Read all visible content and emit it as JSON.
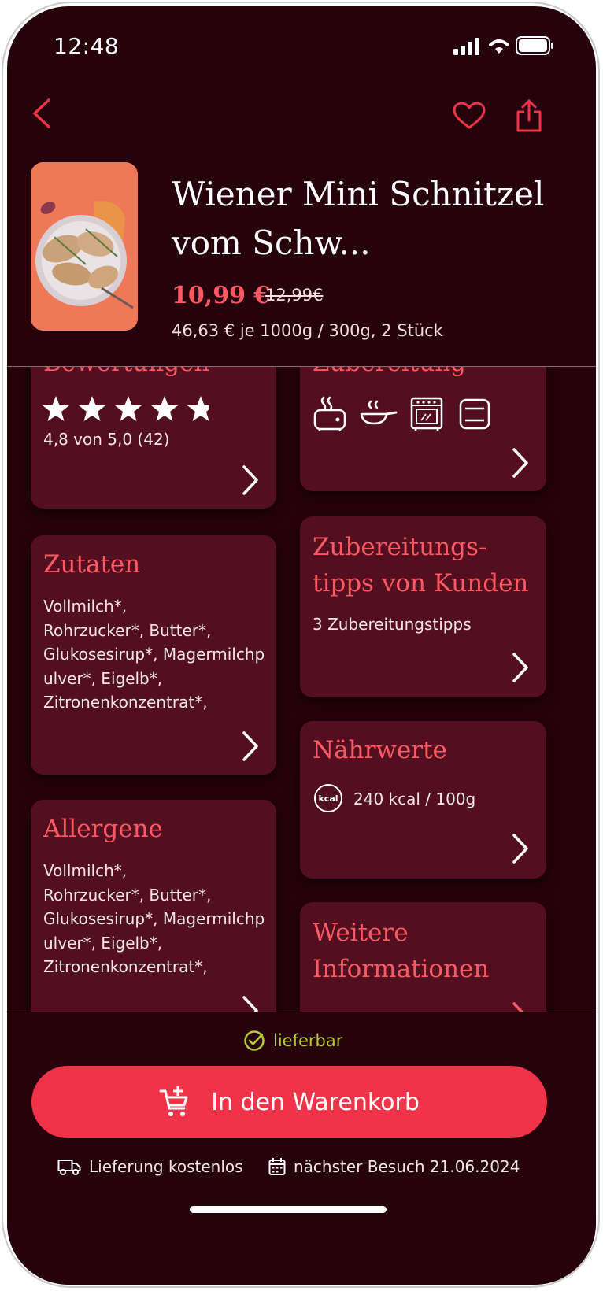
{
  "status_bar": {
    "time": "12:48"
  },
  "toolbar": {
    "back_icon": "chevron-left-icon",
    "favorite_icon": "heart-icon",
    "share_icon": "share-icon"
  },
  "product": {
    "title": "Wiener Mini Schnitzel vom Schw...",
    "price": "10,99 €",
    "old_price": "12,99€",
    "unit_price": "46,63 € je 1000g / 300g, 2 Stück"
  },
  "cards": {
    "ratings": {
      "title": "Bewertungen",
      "stars": 4.8,
      "text": "4,8 von 5,0 (42)"
    },
    "preparation": {
      "title": "Zubereitung",
      "icons": [
        "toaster-icon",
        "pan-icon",
        "oven-icon",
        "microwave-icon"
      ]
    },
    "ingredients": {
      "title": "Zutaten",
      "text": [
        "Vollmilch*,",
        "Rohrzucker*, Butter*,",
        "Glukosesirup*, Magermilchp",
        "ulver*, Eigelb*,",
        "Zitronenkonzentrat*,"
      ]
    },
    "tips": {
      "title_line1": "Zubereitungs-",
      "title_line2": "tipps von Kunden",
      "text": "3 Zubereitungstipps"
    },
    "nutrition": {
      "title": "Nährwerte",
      "badge": "kcal",
      "text": "240 kcal / 100g"
    },
    "allergens": {
      "title": "Allergene",
      "text": [
        "Vollmilch*,",
        "Rohrzucker*, Butter*,",
        "Glukosesirup*, Magermilchp",
        "ulver*, Eigelb*,",
        "Zitronenkonzentrat*,"
      ]
    },
    "more_info": {
      "title_line1": "Weitere",
      "title_line2": "Informationen"
    }
  },
  "footer": {
    "availability": "lieferbar",
    "cart_button": "In den Warenkorb",
    "delivery": "Lieferung kostenlos",
    "next_visit": "nächster Besuch 21.06.2024"
  },
  "colors": {
    "background": "#26020c",
    "card": "#530f1f",
    "accent": "#ff5a63",
    "button": "#f03348",
    "available": "#b6c93a"
  }
}
